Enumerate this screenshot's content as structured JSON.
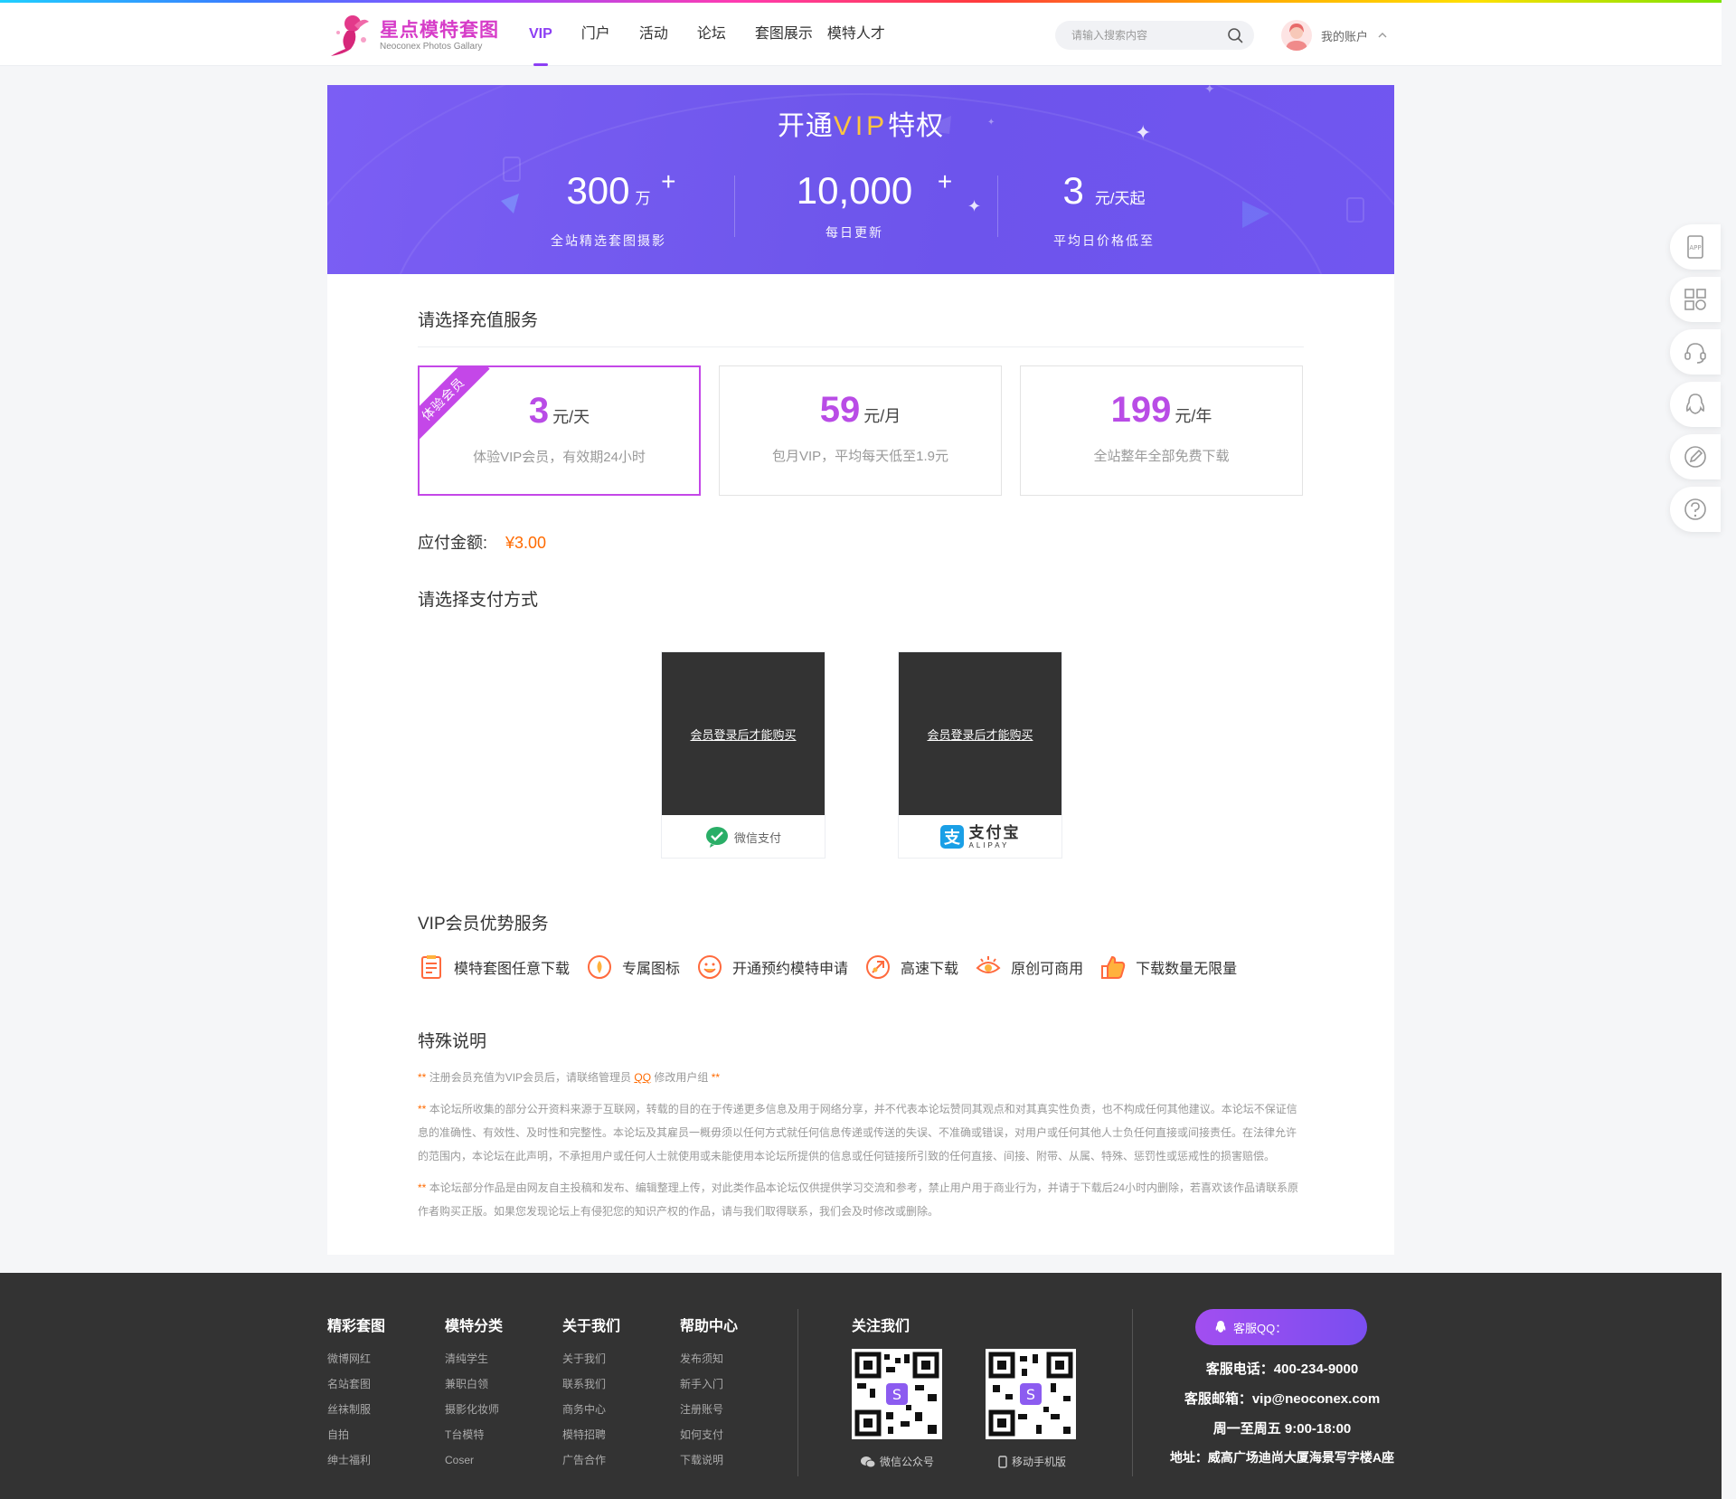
{
  "header": {
    "logo_title": "星点模特套图",
    "logo_sub": "Neoconex Photos Gallary",
    "nav": [
      "VIP",
      "门户",
      "活动",
      "论坛",
      "套图展示",
      "模特人才"
    ],
    "search_placeholder": "请输入搜索内容",
    "account_label": "我的账户"
  },
  "banner": {
    "title_pre": "开通",
    "title_vip": "VIP",
    "title_post": "特权",
    "stats": [
      {
        "num": "300",
        "unit": "万",
        "plus": "+",
        "desc": "全站精选套图摄影"
      },
      {
        "num": "10,000",
        "unit": "",
        "plus": "+",
        "desc": "每日更新"
      },
      {
        "num": "3",
        "unit": "元/天起",
        "plus": "",
        "desc": "平均日价格低至"
      }
    ]
  },
  "recharge": {
    "title": "请选择充值服务",
    "plans": [
      {
        "num": "3",
        "unit": "元/天",
        "desc": "体验VIP会员，有效期24小时",
        "ribbon": "体验会员"
      },
      {
        "num": "59",
        "unit": "元/月",
        "desc": "包月VIP，平均每天低至1.9元"
      },
      {
        "num": "199",
        "unit": "元/年",
        "desc": "全站整年全部免费下载"
      }
    ],
    "amount_label": "应付金额:",
    "amount_value": "¥3.00"
  },
  "payment": {
    "title": "请选择支付方式",
    "methods": [
      {
        "login_text": "会员登录后才能购买",
        "label": "微信支付"
      },
      {
        "login_text": "会员登录后才能购买",
        "label": "支付宝",
        "sub": "ALIPAY"
      }
    ]
  },
  "advantages": {
    "title": "VIP会员优势服务",
    "items": [
      "模特套图任意下载",
      "专属图标",
      "开通预约模特申请",
      "高速下载",
      "原创可商用",
      "下载数量无限量"
    ]
  },
  "notes": {
    "title": "特殊说明",
    "stars": "**",
    "line1_pre": "注册会员充值为VIP会员后，请联络管理员",
    "line1_qq": "QQ",
    "line1_post": "修改用户组",
    "para2": "本论坛所收集的部分公开资料来源于互联网，转载的目的在于传递更多信息及用于网络分享，并不代表本论坛赞同其观点和对其真实性负责，也不构成任何其他建议。本论坛不保证信息的准确性、有效性、及时性和完整性。本论坛及其雇员一概毋须以任何方式就任何信息传递或传送的失误、不准确或错误，对用户或任何其他人士负任何直接或间接责任。在法律允许的范围内，本论坛在此声明，不承担用户或任何人士就使用或未能使用本论坛所提供的信息或任何链接所引致的任何直接、间接、附带、从属、特殊、惩罚性或惩戒性的损害赔偿。",
    "para3": "本论坛部分作品是由网友自主投稿和发布、编辑整理上传，对此类作品本论坛仅供提供学习交流和参考，禁止用户用于商业行为，并请于下载后24小时内删除，若喜欢该作品请联系原作者购买正版。如果您发现论坛上有侵犯您的知识产权的作品，请与我们取得联系，我们会及时修改或删除。"
  },
  "footer": {
    "columns": [
      {
        "title": "精彩套图",
        "links": [
          "微博网红",
          "名站套图",
          "丝袜制服",
          "自拍",
          "绅士福利"
        ]
      },
      {
        "title": "模特分类",
        "links": [
          "清纯学生",
          "兼职白领",
          "摄影化妆师",
          "T台模特",
          "Coser"
        ]
      },
      {
        "title": "关于我们",
        "links": [
          "关于我们",
          "联系我们",
          "商务中心",
          "模特招聘",
          "广告合作"
        ]
      },
      {
        "title": "帮助中心",
        "links": [
          "发布须知",
          "新手入门",
          "注册账号",
          "如何支付",
          "下载说明"
        ]
      }
    ],
    "follow_title": "关注我们",
    "qr_labels": [
      "微信公众号",
      "移动手机版"
    ],
    "qq_label": "客服QQ：",
    "phone": "客服电话：400-234-9000",
    "email": "客服邮箱：vip@neoconex.com",
    "hours": "周一至周五 9:00-18:00",
    "address": "地址：威高广场迪尚大厦海景写字楼A座"
  },
  "colors": {
    "accent": "#8c3ff4",
    "banner": "#6f57ec",
    "price": "#b94ce6",
    "amount": "#ff6a00",
    "footer": "#333333"
  },
  "float_icons": [
    "app-icon",
    "qrcode-icon",
    "headset-icon",
    "qq-icon",
    "edit-icon",
    "help-icon"
  ]
}
